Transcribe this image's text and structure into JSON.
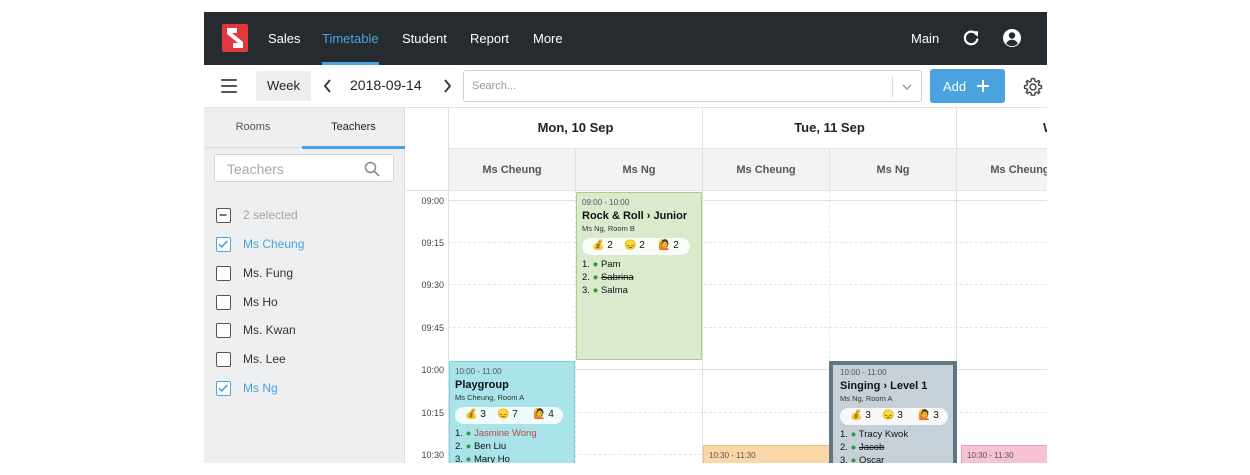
{
  "nav": {
    "items": [
      "Sales",
      "Timetable",
      "Student",
      "Report",
      "More"
    ],
    "active": "Timetable",
    "main_label": "Main",
    "refresh_icon": "refresh-icon",
    "account_icon": "account-circle-icon"
  },
  "toolbar": {
    "view": "Week",
    "date": "2018-09-14",
    "search_placeholder": "Search...",
    "add_label": "Add"
  },
  "sidebar": {
    "tabs": [
      "Rooms",
      "Teachers"
    ],
    "active_tab": "Teachers",
    "filter_placeholder": "Teachers",
    "summary": "2 selected",
    "teachers": [
      {
        "name": "Ms Cheung",
        "checked": true
      },
      {
        "name": "Ms. Fung",
        "checked": false
      },
      {
        "name": "Ms Ho",
        "checked": false
      },
      {
        "name": "Ms. Kwan",
        "checked": false
      },
      {
        "name": "Ms. Lee",
        "checked": false
      },
      {
        "name": "Ms Ng",
        "checked": true
      }
    ]
  },
  "calendar": {
    "days": [
      "Mon, 10 Sep",
      "Tue, 11 Sep",
      "W"
    ],
    "teachers": [
      "Ms Cheung",
      "Ms Ng",
      "Ms Cheung",
      "Ms Ng",
      "Ms Cheung"
    ],
    "times": [
      "09:00",
      "09:15",
      "09:30",
      "09:45",
      "10:00",
      "10:15",
      "10:30"
    ],
    "events": [
      {
        "time": "09:00 - 10:00",
        "title": "Rock & Roll › Junior",
        "room": "Ms Ng, Room B",
        "stats": [
          "2",
          "2",
          "2"
        ],
        "students": [
          {
            "n": "1.",
            "name": "Pam",
            "state": "ok"
          },
          {
            "n": "2.",
            "name": "Sabrina",
            "state": "cancelled"
          },
          {
            "n": "3.",
            "name": "Salma",
            "state": "ok"
          }
        ],
        "color": "#dbe9cc",
        "border": "#a8d08a"
      },
      {
        "time": "10:00 - 11:00",
        "title": "Playgroup",
        "room": "Ms Cheung, Room A",
        "stats": [
          "3",
          "7",
          "4"
        ],
        "students": [
          {
            "n": "1.",
            "name": "Jasmine Wong",
            "state": "warn"
          },
          {
            "n": "2.",
            "name": "Ben Liu",
            "state": "ok"
          },
          {
            "n": "3.",
            "name": "Mary Ho",
            "state": "ok"
          }
        ],
        "color": "#a8e4ea",
        "border": "#7fd0d8"
      },
      {
        "time": "10:00 - 11:00",
        "title": "Singing › Level 1",
        "room": "Ms Ng, Room A",
        "stats": [
          "3",
          "3",
          "3"
        ],
        "students": [
          {
            "n": "1.",
            "name": "Tracy Kwok",
            "state": "ok"
          },
          {
            "n": "2.",
            "name": "Jacob",
            "state": "cancelled"
          },
          {
            "n": "3.",
            "name": "Oscar",
            "state": "ok"
          }
        ],
        "color": "#c6d0d8",
        "border": "#5f7583"
      },
      {
        "time": "10:30 - 11:30",
        "title": "",
        "room": "",
        "stats": [],
        "students": [],
        "color": "#fbd7a8",
        "border": "#f0bf84"
      },
      {
        "time": "10:30 - 11:30",
        "title": "",
        "room": "",
        "stats": [],
        "students": [],
        "color": "#f7c2d2",
        "border": "#ee9ab4"
      }
    ]
  },
  "colors": {
    "nav_bg": "#262b2f",
    "accent": "#4aa3df",
    "logo": "#e0383e"
  }
}
